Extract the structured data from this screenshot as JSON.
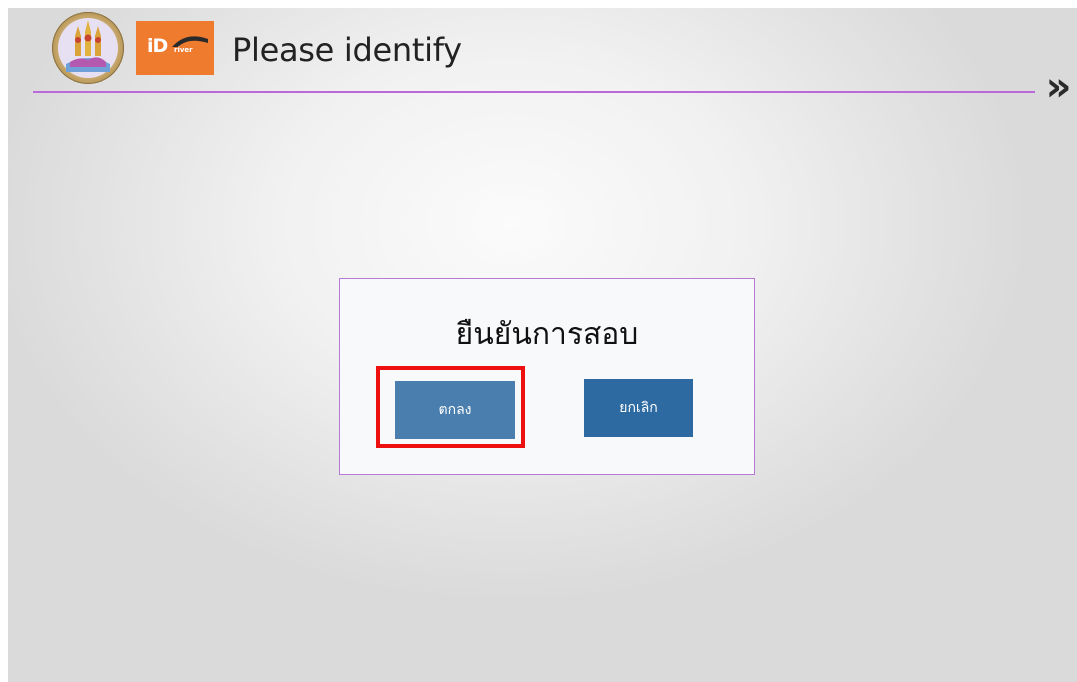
{
  "header": {
    "title": "Please identify",
    "seal_logo": {
      "icon": "department-seal-icon"
    },
    "app_logo": {
      "icon": "idriver-logo-icon",
      "text_main": "iD",
      "text_sub": "river",
      "bg_color": "#ef7b2f"
    },
    "next_button": {
      "label": "»"
    },
    "accent_color": "#b76ad8"
  },
  "dialog": {
    "title": "ยืนยันการสอบ",
    "ok_button": {
      "label": "ตกลง",
      "color": "#4a7eae",
      "highlighted": true
    },
    "cancel_button": {
      "label": "ยกเลิก",
      "color": "#2d6aa1"
    },
    "highlight_color": "#ee0f0f",
    "border_color": "#b67ad6"
  }
}
